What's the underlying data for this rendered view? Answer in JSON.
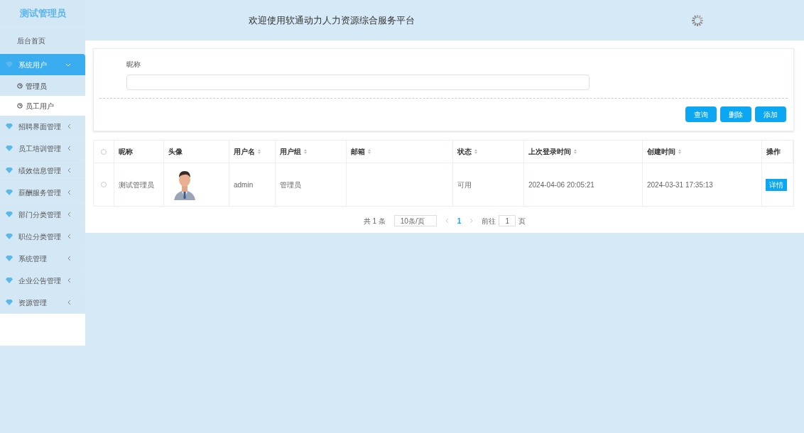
{
  "sidebar": {
    "title": "测试管理员",
    "items": [
      {
        "label": "后台首页",
        "kind": "plain",
        "selected": false
      },
      {
        "label": "系统用户",
        "kind": "group",
        "selected": true,
        "expanded": true,
        "children": [
          {
            "label": "管理员",
            "selected": false
          },
          {
            "label": "员工用户",
            "selected": true
          }
        ]
      },
      {
        "label": "招聘界面管理",
        "kind": "group",
        "selected": false,
        "expanded": false
      },
      {
        "label": "员工培训管理",
        "kind": "group",
        "selected": false,
        "expanded": false
      },
      {
        "label": "绩效信息管理",
        "kind": "group",
        "selected": false,
        "expanded": false
      },
      {
        "label": "薪酬服务管理",
        "kind": "group",
        "selected": false,
        "expanded": false
      },
      {
        "label": "部门分类管理",
        "kind": "group",
        "selected": false,
        "expanded": false
      },
      {
        "label": "职位分类管理",
        "kind": "group",
        "selected": false,
        "expanded": false
      },
      {
        "label": "系统管理",
        "kind": "group",
        "selected": false,
        "expanded": false
      },
      {
        "label": "企业公告管理",
        "kind": "group",
        "selected": false,
        "expanded": false
      },
      {
        "label": "资源管理",
        "kind": "group",
        "selected": false,
        "expanded": false
      }
    ]
  },
  "header": {
    "title": "欢迎使用软通动力人力资源综合服务平台"
  },
  "search": {
    "label": "昵称",
    "buttons": [
      "查询",
      "删除",
      "添加"
    ]
  },
  "table": {
    "select_all_checked": false,
    "columns": [
      {
        "label": "昵称",
        "sortable": false
      },
      {
        "label": "头像",
        "sortable": false
      },
      {
        "label": "用户名",
        "sortable": true
      },
      {
        "label": "用户组",
        "sortable": true
      },
      {
        "label": "邮箱",
        "sortable": true
      },
      {
        "label": "状态",
        "sortable": true
      },
      {
        "label": "上次登录时间",
        "sortable": true
      },
      {
        "label": "创建时间",
        "sortable": true
      },
      {
        "label": "操作",
        "sortable": false
      }
    ],
    "rows": [
      {
        "checked": false,
        "cells": [
          "测试管理员",
          {
            "kind": "picture"
          },
          "admin",
          "管理员",
          "",
          "可用",
          "2024-04-06 20:05:21",
          "2024-03-31 17:35:13"
        ],
        "action": "详情"
      }
    ]
  },
  "pagination": {
    "total": "共 1 条",
    "page_size": "10条/页",
    "pages": [
      {
        "label": "1",
        "selected": true
      }
    ],
    "goto_label": "前往",
    "goto_value": "1",
    "goto_suffix": "页"
  }
}
